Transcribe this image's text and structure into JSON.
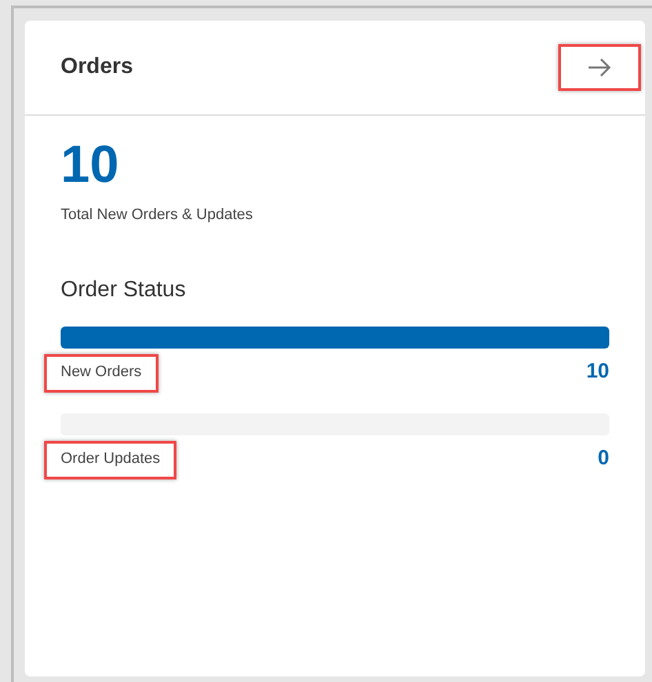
{
  "card": {
    "title": "Orders",
    "arrow_highlighted": true
  },
  "total": {
    "value": "10",
    "caption": "Total New Orders & Updates"
  },
  "status": {
    "heading": "Order Status",
    "rows": [
      {
        "label": "New Orders",
        "value": "10",
        "level": 1,
        "highlighted": true
      },
      {
        "label": "Order Updates",
        "value": "0",
        "level": 0,
        "highlighted": true
      }
    ]
  }
}
